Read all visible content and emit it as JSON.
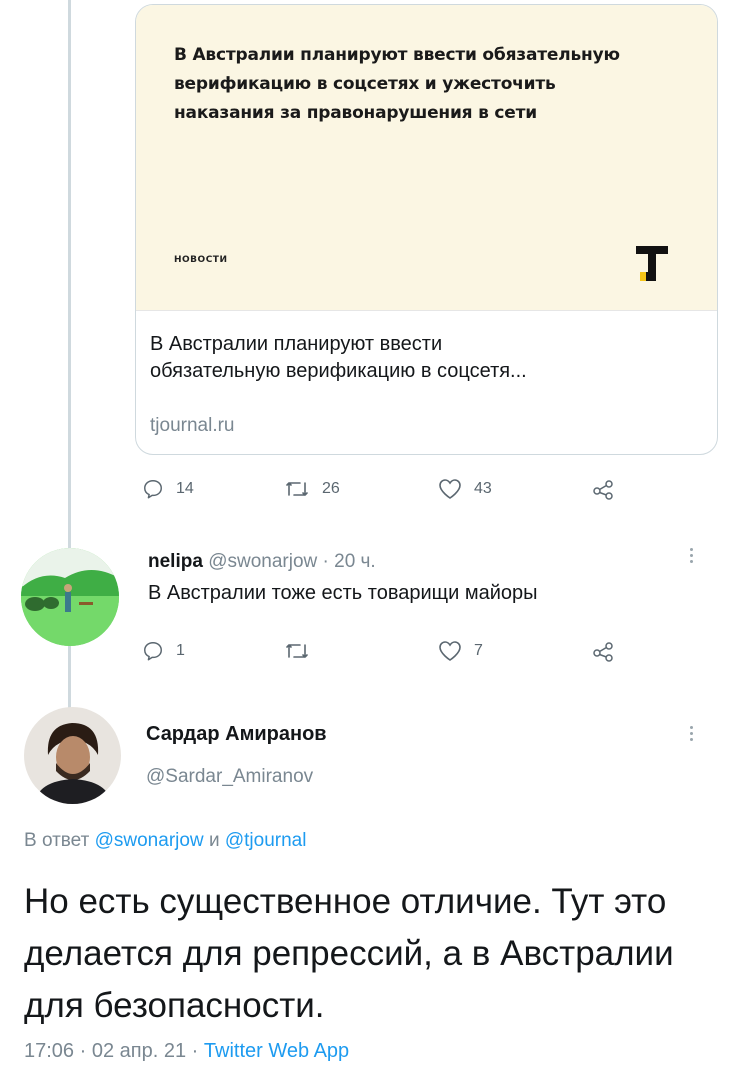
{
  "link_card": {
    "preview_title": "В Австралии планируют ввести обязательную верификацию в соцсетях и ужесточить наказания за правонарушения в сети",
    "preview_category": "новости",
    "title_line1": "В Австралии планируют ввести",
    "title_line2": "обязательную верификацию в соцсетя...",
    "domain": "tjournal.ru",
    "logo_letter": "Т",
    "logo_accent_color": "#f5c518"
  },
  "tweet1_actions": {
    "replies": "14",
    "retweets": "26",
    "likes": "43"
  },
  "tweet2": {
    "name": "nelipa",
    "handle": "@swonarjow",
    "separator": "·",
    "time": "20 ч.",
    "text": "В Австралии тоже есть товарищи майоры",
    "replies": "1",
    "retweets": "",
    "likes": "7"
  },
  "tweet3": {
    "name": "Сардар Амиранов",
    "handle": "@Sardar_Amiranov",
    "reply_prefix": "В ответ",
    "reply_user1": "@swonarjow",
    "reply_and": "и",
    "reply_user2": "@tjournal",
    "text": "Но есть существенное отличие. Тут это делается для репрессий, а в Австралии для безопасности.",
    "time": "17:06",
    "date": "02 апр. 21",
    "separator": "·",
    "app": "Twitter Web App"
  },
  "colors": {
    "link": "#1d9bf0",
    "muted": "#7a8791",
    "thread_line": "#cfd9de",
    "card_bg": "#fbf6e3"
  }
}
